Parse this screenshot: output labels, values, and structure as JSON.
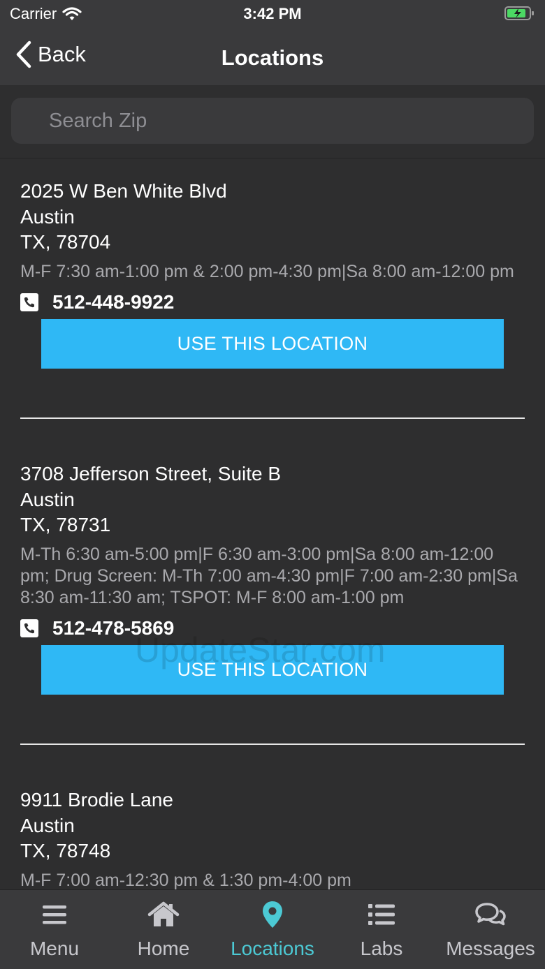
{
  "status_bar": {
    "carrier": "Carrier",
    "time": "3:42 PM"
  },
  "nav": {
    "back_label": "Back",
    "title": "Locations"
  },
  "search": {
    "placeholder": "Search Zip",
    "value": ""
  },
  "locations": [
    {
      "street": "2025 W Ben White Blvd",
      "city": "Austin",
      "state_zip": "TX, 78704",
      "hours": "M-F 7:30 am-1:00 pm & 2:00 pm-4:30 pm|Sa 8:00 am-12:00 pm",
      "phone": "512-448-9922",
      "button_label": "USE THIS LOCATION"
    },
    {
      "street": "3708 Jefferson Street, Suite B",
      "city": "Austin",
      "state_zip": "TX, 78731",
      "hours": "M-Th 6:30 am-5:00 pm|F 6:30 am-3:00 pm|Sa 8:00 am-12:00 pm; Drug Screen: M-Th 7:00 am-4:30 pm|F 7:00 am-2:30 pm|Sa 8:30 am-11:30 am; TSPOT: M-F 8:00 am-1:00 pm",
      "phone": "512-478-5869",
      "button_label": "USE THIS LOCATION"
    },
    {
      "street": "9911 Brodie Lane",
      "city": "Austin",
      "state_zip": "TX, 78748",
      "hours": "M-F 7:00 am-12:30 pm & 1:30 pm-4:00 pm"
    }
  ],
  "tabs": [
    {
      "label": "Menu",
      "icon": "menu-icon"
    },
    {
      "label": "Home",
      "icon": "home-icon"
    },
    {
      "label": "Locations",
      "icon": "location-pin-icon",
      "active": true
    },
    {
      "label": "Labs",
      "icon": "list-icon"
    },
    {
      "label": "Messages",
      "icon": "chat-icon"
    }
  ],
  "watermark": "UpdateStar.com",
  "colors": {
    "accent_button": "#2fb8f5",
    "active_tab": "#4cc9d4",
    "background": "#2e2e2f",
    "bar": "#3a3a3c"
  }
}
